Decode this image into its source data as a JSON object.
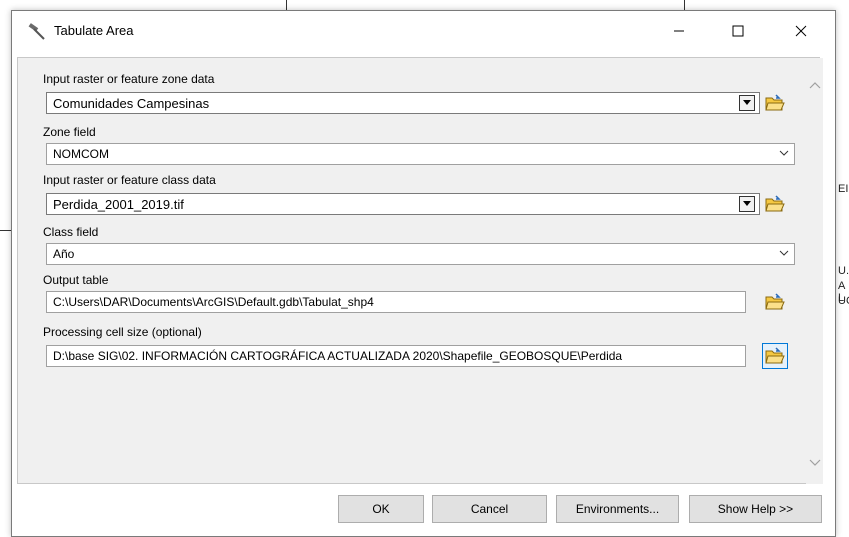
{
  "window": {
    "title": "Tabulate Area",
    "icons": {
      "app": "hammer-icon",
      "minimize": "minimize-icon",
      "maximize": "maximize-icon",
      "close": "close-icon"
    }
  },
  "form": {
    "zone_data_label": "Input raster or feature zone data",
    "zone_data_value": "Comunidades Campesinas",
    "zone_field_label": "Zone field",
    "zone_field_value": "NOMCOM",
    "class_data_label": "Input raster or feature class data",
    "class_data_value": "Perdida_2001_2019.tif",
    "class_field_label": "Class field",
    "class_field_value": "Año",
    "output_table_label": "Output table",
    "output_table_value": "C:\\Users\\DAR\\Documents\\ArcGIS\\Default.gdb\\Tabulat_shp4",
    "cell_size_label": "Processing cell size (optional)",
    "cell_size_value": "D:\\base SIG\\02. INFORMACIÓN CARTOGRÁFICA ACTUALIZADA 2020\\Shapefile_GEOBOSQUE\\Perdida"
  },
  "buttons": {
    "ok": "OK",
    "cancel": "Cancel",
    "environments": "Environments...",
    "show_help": "Show Help >>"
  },
  "background_map": {
    "frag1": "EI",
    "frag2": "U.",
    "frag3": "A L",
    "frag4": "UC"
  },
  "colors": {
    "accent": "#0078d7",
    "panel": "#f0f0f0",
    "folder": "#e8b923"
  }
}
